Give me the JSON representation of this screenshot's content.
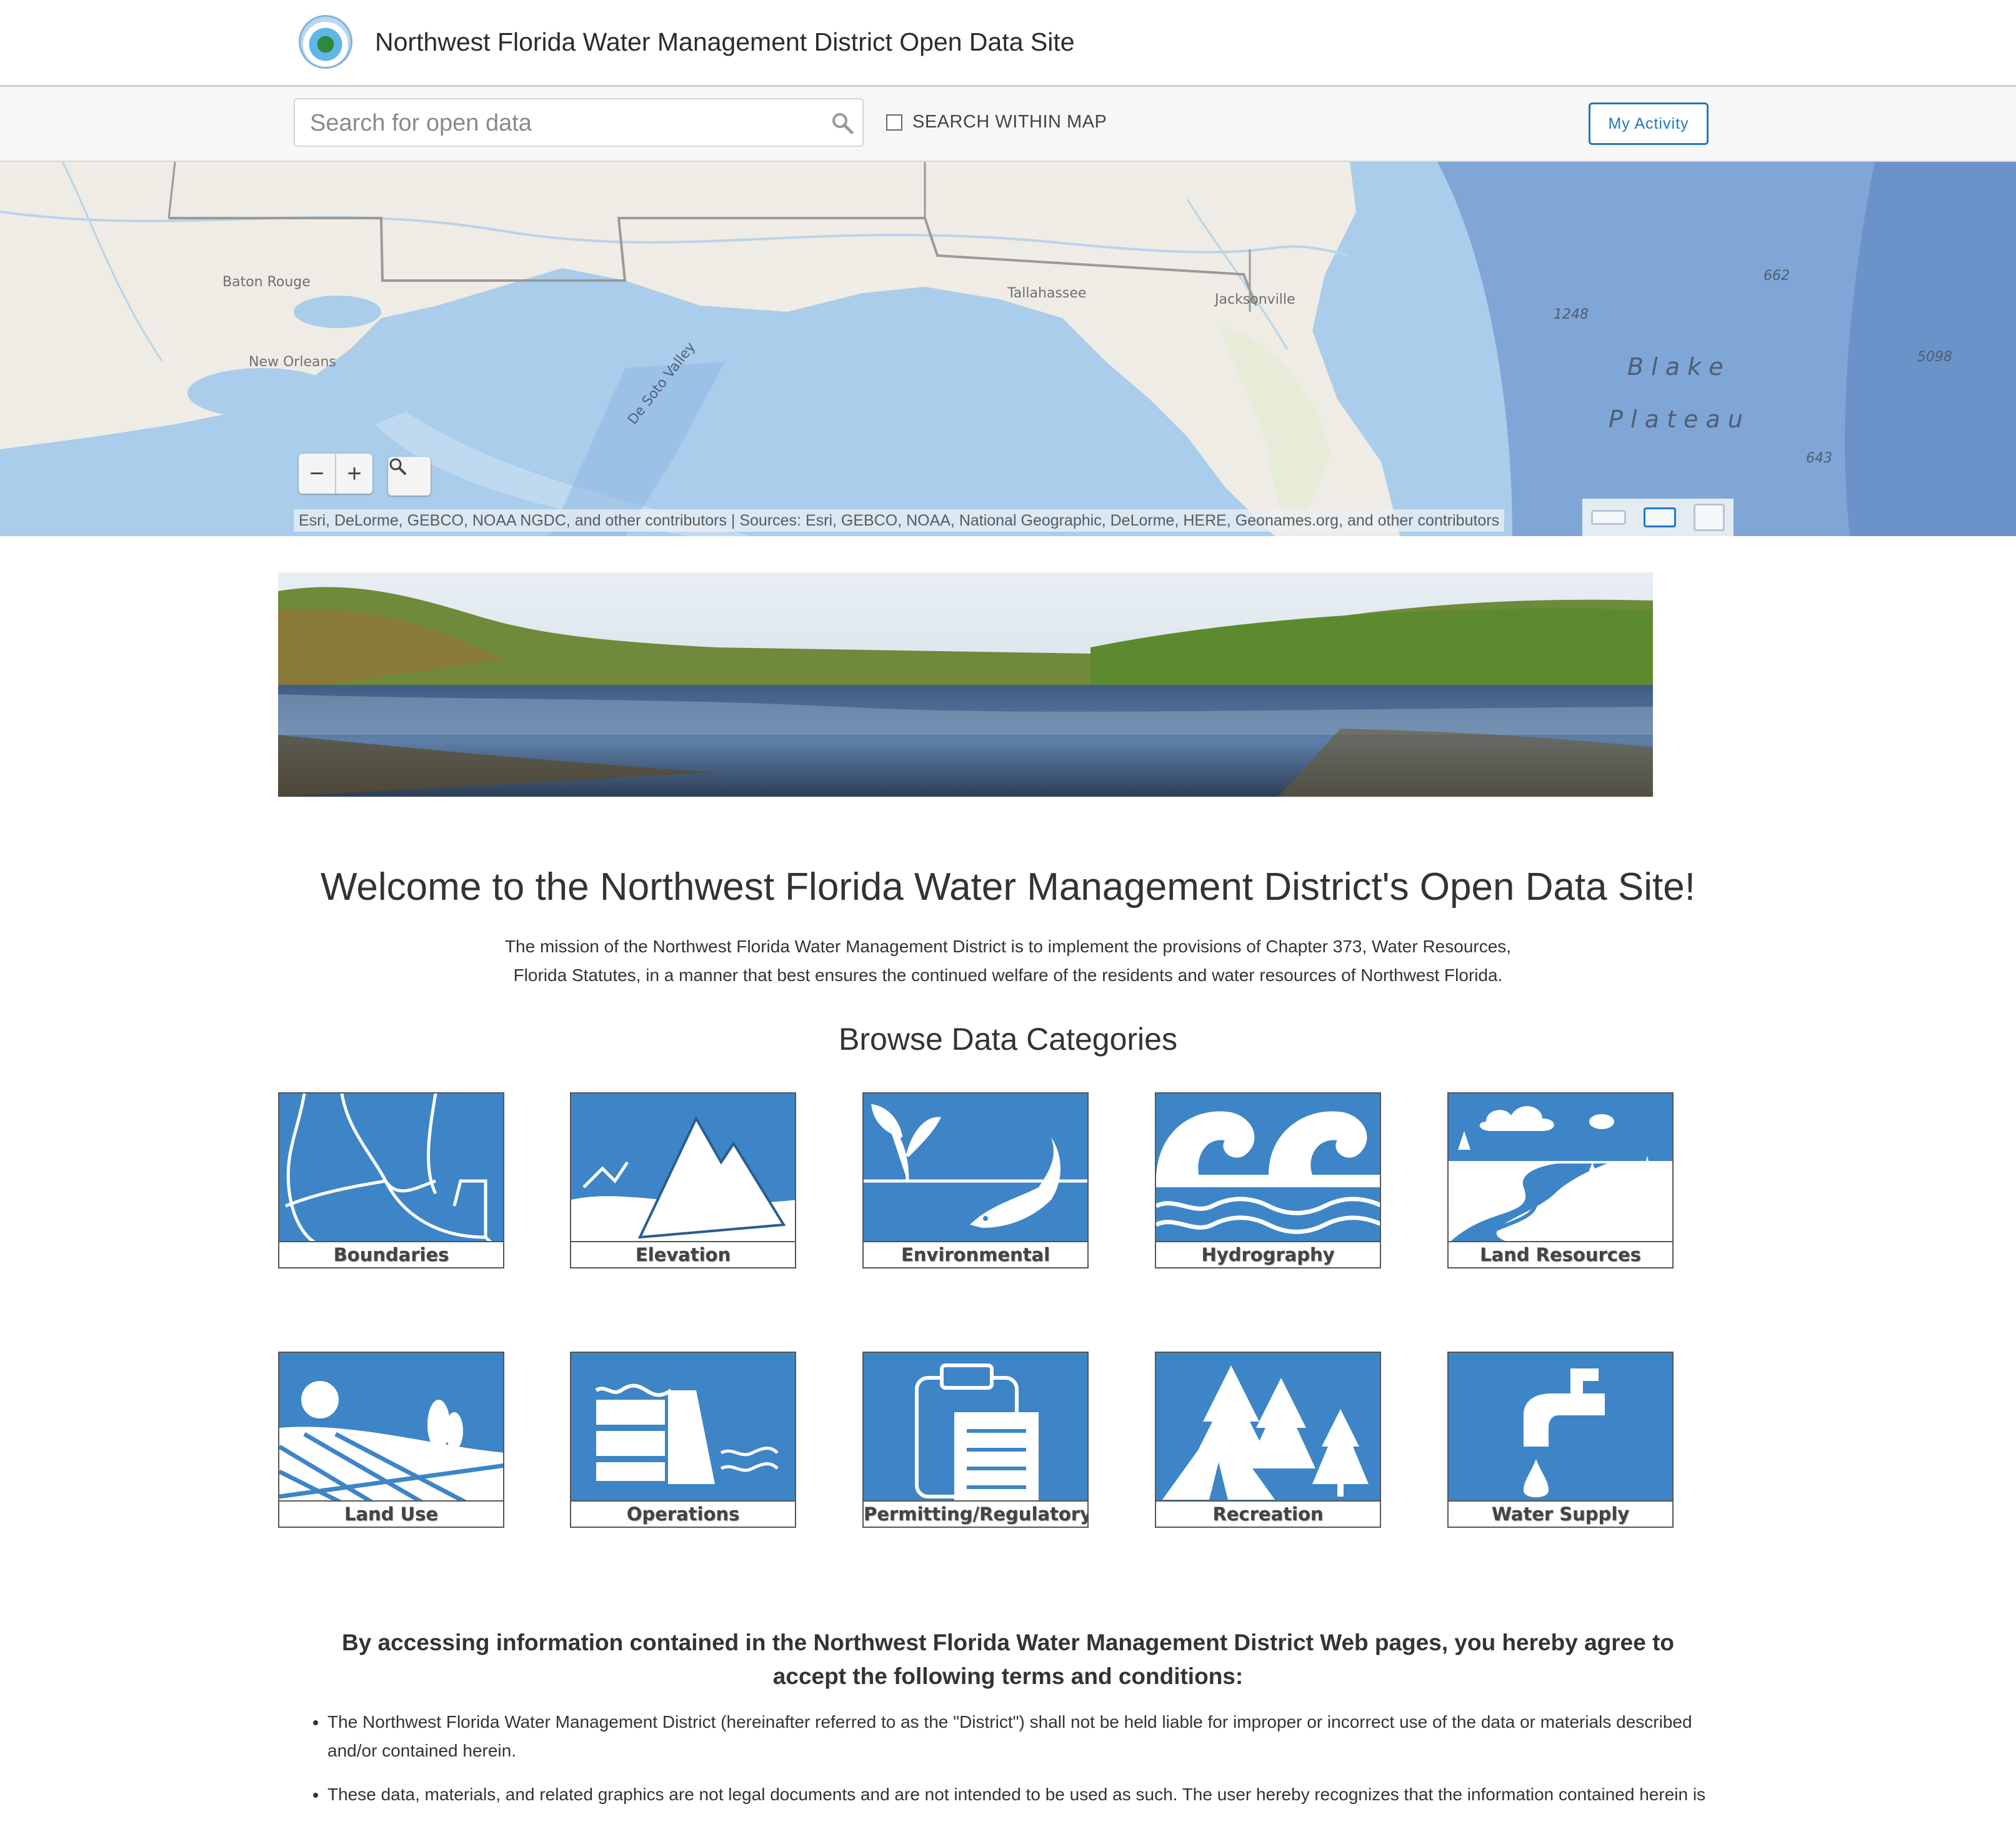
{
  "header": {
    "title": "Northwest Florida Water Management District Open Data Site"
  },
  "search": {
    "placeholder": "Search for open data",
    "within_map_label": "SEARCH WITHIN MAP",
    "my_activity_label": "My Activity"
  },
  "map": {
    "places": [
      "Baton Rouge",
      "New Orleans",
      "Tallahassee",
      "Jacksonville",
      "De Soto Valley"
    ],
    "depths": [
      "662",
      "1248",
      "5098",
      "643"
    ],
    "plateau_line1": "B l a k e",
    "plateau_line2": "P l a t e a u",
    "zoom_out": "−",
    "zoom_in": "+",
    "attribution": "Esri, DeLorme, GEBCO, NOAA NGDC, and other contributors |  Sources: Esri, GEBCO, NOAA, National Geographic, DeLorme, HERE, Geonames.org, and other contributors"
  },
  "welcome": {
    "heading": "Welcome to the Northwest Florida Water Management District's Open Data Site!",
    "mission_line1": "The mission of the Northwest Florida Water Management District is to implement the provisions of Chapter 373, Water Resources,",
    "mission_line2": "Florida Statutes, in a manner that best ensures the continued welfare of the residents and water resources of Northwest Florida."
  },
  "categories": {
    "heading": "Browse Data Categories",
    "items": [
      "Boundaries",
      "Elevation",
      "Environmental",
      "Hydrography",
      "Land Resources",
      "Land Use",
      "Operations",
      "Permitting/Regulatory",
      "Recreation",
      "Water Supply"
    ],
    "tile_color": "#3d85c6"
  },
  "terms": {
    "heading": "By accessing information contained in the Northwest Florida Water Management District Web pages, you hereby agree to accept the following terms and conditions:",
    "items": [
      "The Northwest Florida Water Management District (hereinafter referred to as the \"District\") shall not be held liable for improper or incorrect use of the data or materials described and/or contained herein.",
      "These data, materials, and related graphics are not legal documents and are not intended to be used as such. The user hereby recognizes that the information contained herein is"
    ]
  }
}
